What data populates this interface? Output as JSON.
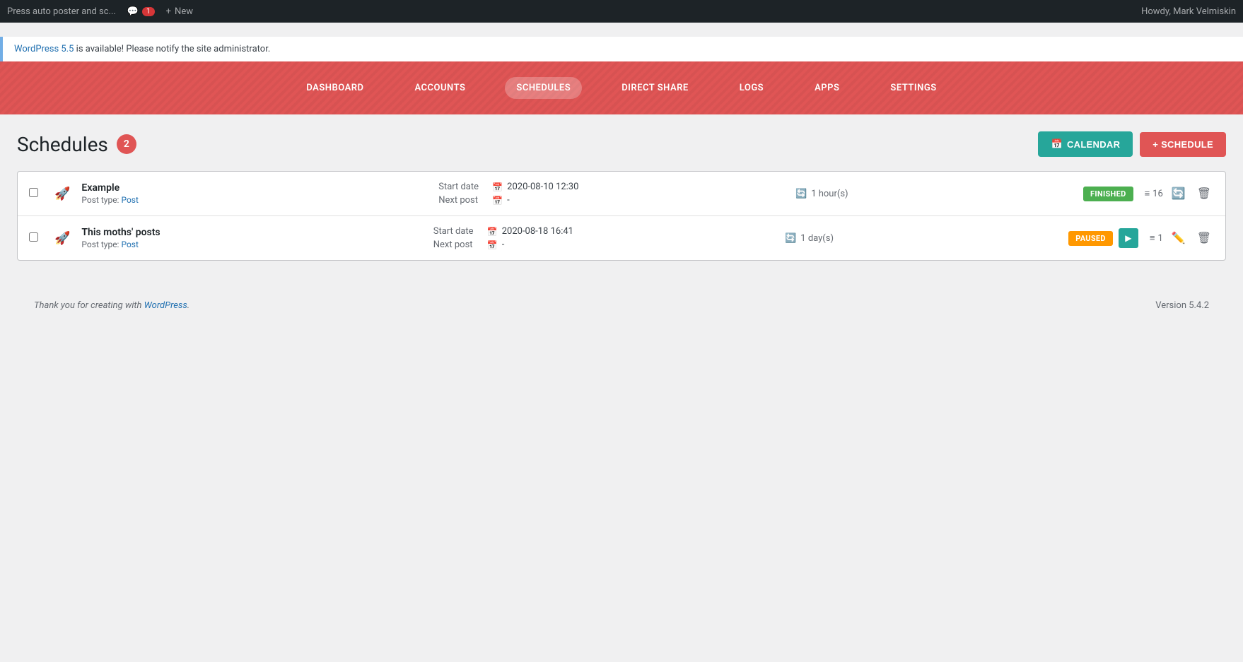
{
  "adminBar": {
    "title": "Press auto poster and sc...",
    "comments": {
      "icon": "💬",
      "count": "1"
    },
    "newLabel": "New",
    "userGreeting": "Howdy, Mark Velmiskin"
  },
  "notification": {
    "linkText": "WordPress 5.5",
    "message": " is available! Please notify the site administrator."
  },
  "nav": {
    "items": [
      {
        "label": "DASHBOARD",
        "active": false
      },
      {
        "label": "ACCOUNTS",
        "active": false
      },
      {
        "label": "SCHEDULES",
        "active": true
      },
      {
        "label": "DIRECT SHARE",
        "active": false
      },
      {
        "label": "LOGS",
        "active": false
      },
      {
        "label": "APPS",
        "active": false
      },
      {
        "label": "SETTINGS",
        "active": false
      }
    ]
  },
  "page": {
    "title": "Schedules",
    "count": "2",
    "calendarButton": "CALENDAR",
    "scheduleButton": "+ SCHEDULE"
  },
  "schedules": [
    {
      "name": "Example",
      "postType": "Post",
      "startDate": "2020-08-10 12:30",
      "nextPost": "-",
      "interval": "1 hour(s)",
      "status": "FINISHED",
      "postsCount": "16",
      "actions": [
        "list",
        "refresh",
        "delete"
      ]
    },
    {
      "name": "This moths' posts",
      "postType": "Post",
      "startDate": "2020-08-18 16:41",
      "nextPost": "-",
      "interval": "1 day(s)",
      "status": "PAUSED",
      "postsCount": "1",
      "actions": [
        "list",
        "edit",
        "delete"
      ]
    }
  ],
  "footer": {
    "text": "Thank you for creating with ",
    "linkText": "WordPress",
    "version": "Version 5.4.2"
  },
  "labels": {
    "startDate": "Start date",
    "nextPost": "Next post",
    "postTypePrefix": "Post type: "
  }
}
